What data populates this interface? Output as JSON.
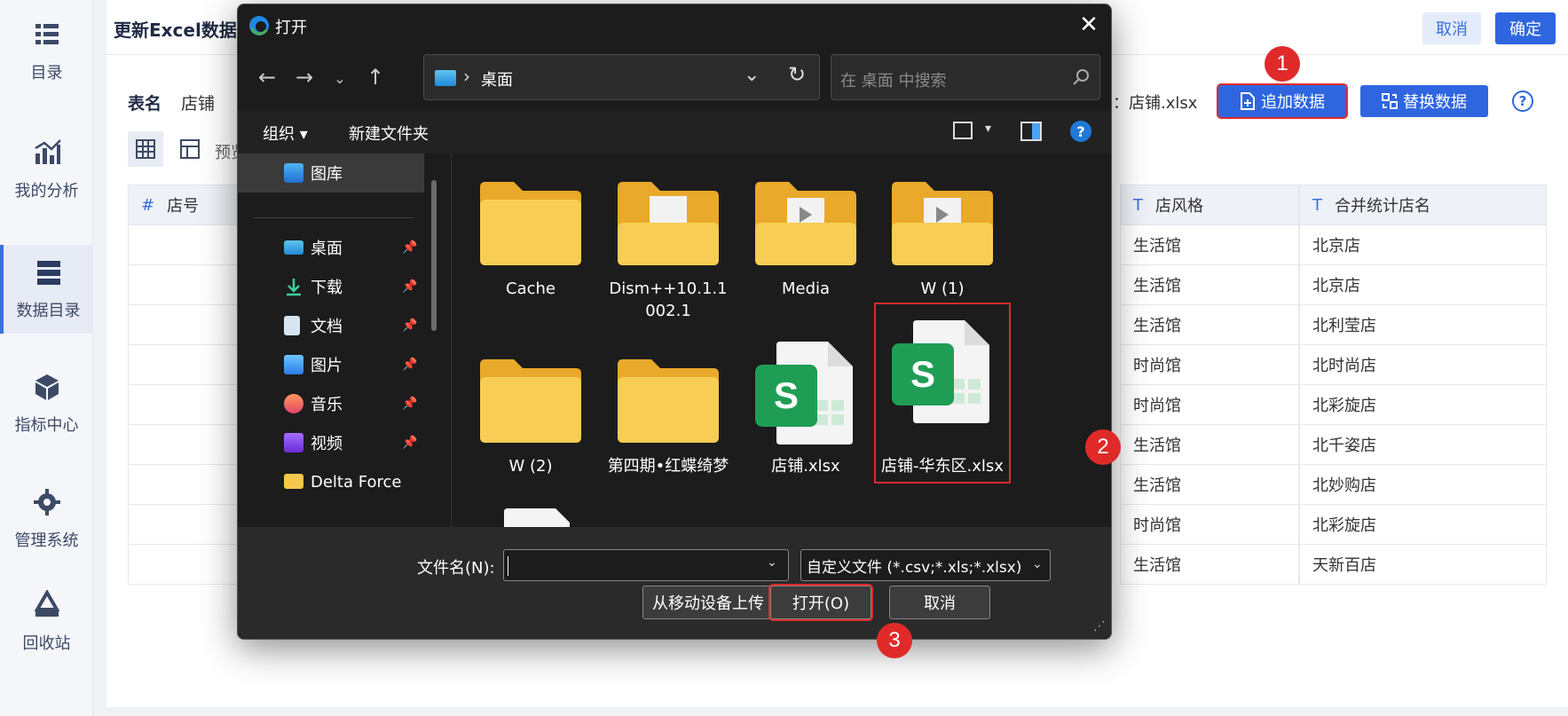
{
  "nav": {
    "items": [
      {
        "label": "目录",
        "icon": "catalog-icon"
      },
      {
        "label": "我的分析",
        "icon": "chart-icon"
      },
      {
        "label": "数据目录",
        "icon": "database-icon"
      },
      {
        "label": "指标中心",
        "icon": "cube-icon"
      },
      {
        "label": "管理系统",
        "icon": "gear-icon"
      },
      {
        "label": "回收站",
        "icon": "recycle-icon"
      }
    ]
  },
  "page": {
    "title": "更新Excel数据",
    "cancel": "取消",
    "confirm": "确定",
    "table_label": "表名",
    "table_name": "店铺",
    "file_label": "：店铺.xlsx",
    "append": "追加数据",
    "replace": "替换数据",
    "help": "?",
    "preview": "预览"
  },
  "table": {
    "headers": [
      "店号",
      "店风格",
      "合并统计店名"
    ],
    "header_types": [
      "#",
      "T",
      "T"
    ],
    "style_col": [
      "生活馆",
      "生活馆",
      "生活馆",
      "时尚馆",
      "时尚馆",
      "生活馆",
      "生活馆",
      "时尚馆",
      "生活馆"
    ],
    "name_col": [
      "北京店",
      "北京店",
      "北利莹店",
      "北时尚店",
      "北彩旋店",
      "北千姿店",
      "北妙购店",
      "北彩旋店",
      "天新百店"
    ]
  },
  "dialog": {
    "title": "打开",
    "close": "✕",
    "address": "桌面",
    "search_placeholder": "在 桌面 中搜索",
    "organize": "组织",
    "new_folder": "新建文件夹",
    "help": "?",
    "sidebar": [
      {
        "label": "图库",
        "icon": "gallery-icon",
        "pinned": false
      },
      {
        "label": "桌面",
        "icon": "desktop-icon",
        "pinned": true
      },
      {
        "label": "下载",
        "icon": "download-icon",
        "pinned": true
      },
      {
        "label": "文档",
        "icon": "document-icon",
        "pinned": true
      },
      {
        "label": "图片",
        "icon": "picture-icon",
        "pinned": true
      },
      {
        "label": "音乐",
        "icon": "music-icon",
        "pinned": true
      },
      {
        "label": "视频",
        "icon": "video-icon",
        "pinned": true
      },
      {
        "label": "Delta Force",
        "icon": "folder-icon",
        "pinned": false
      }
    ],
    "files": [
      {
        "name": "Cache",
        "kind": "folder"
      },
      {
        "name": "Dism++10.1.1002.1",
        "kind": "folder-doc"
      },
      {
        "name": "Media",
        "kind": "folder-media"
      },
      {
        "name": "W (1)",
        "kind": "folder-media"
      },
      {
        "name": "W (2)",
        "kind": "folder"
      },
      {
        "name": "第四期•红蝶绮梦",
        "kind": "folder"
      },
      {
        "name": "店铺.xlsx",
        "kind": "xlsx"
      },
      {
        "name": "店铺-华东区.xlsx",
        "kind": "xlsx"
      }
    ],
    "filename_label": "文件名(N):",
    "filename_value": "",
    "filetype": "自定义文件 (*.csv;*.xls;*.xlsx)",
    "upload_mobile": "从移动设备上传",
    "open": "打开(O)",
    "cancel": "取消"
  },
  "steps": [
    "1",
    "2",
    "3"
  ],
  "colors": {
    "accent": "#2f66e0",
    "highlight": "#e02a2a",
    "folder": "#f5c74a",
    "excel": "#1f9d55"
  }
}
